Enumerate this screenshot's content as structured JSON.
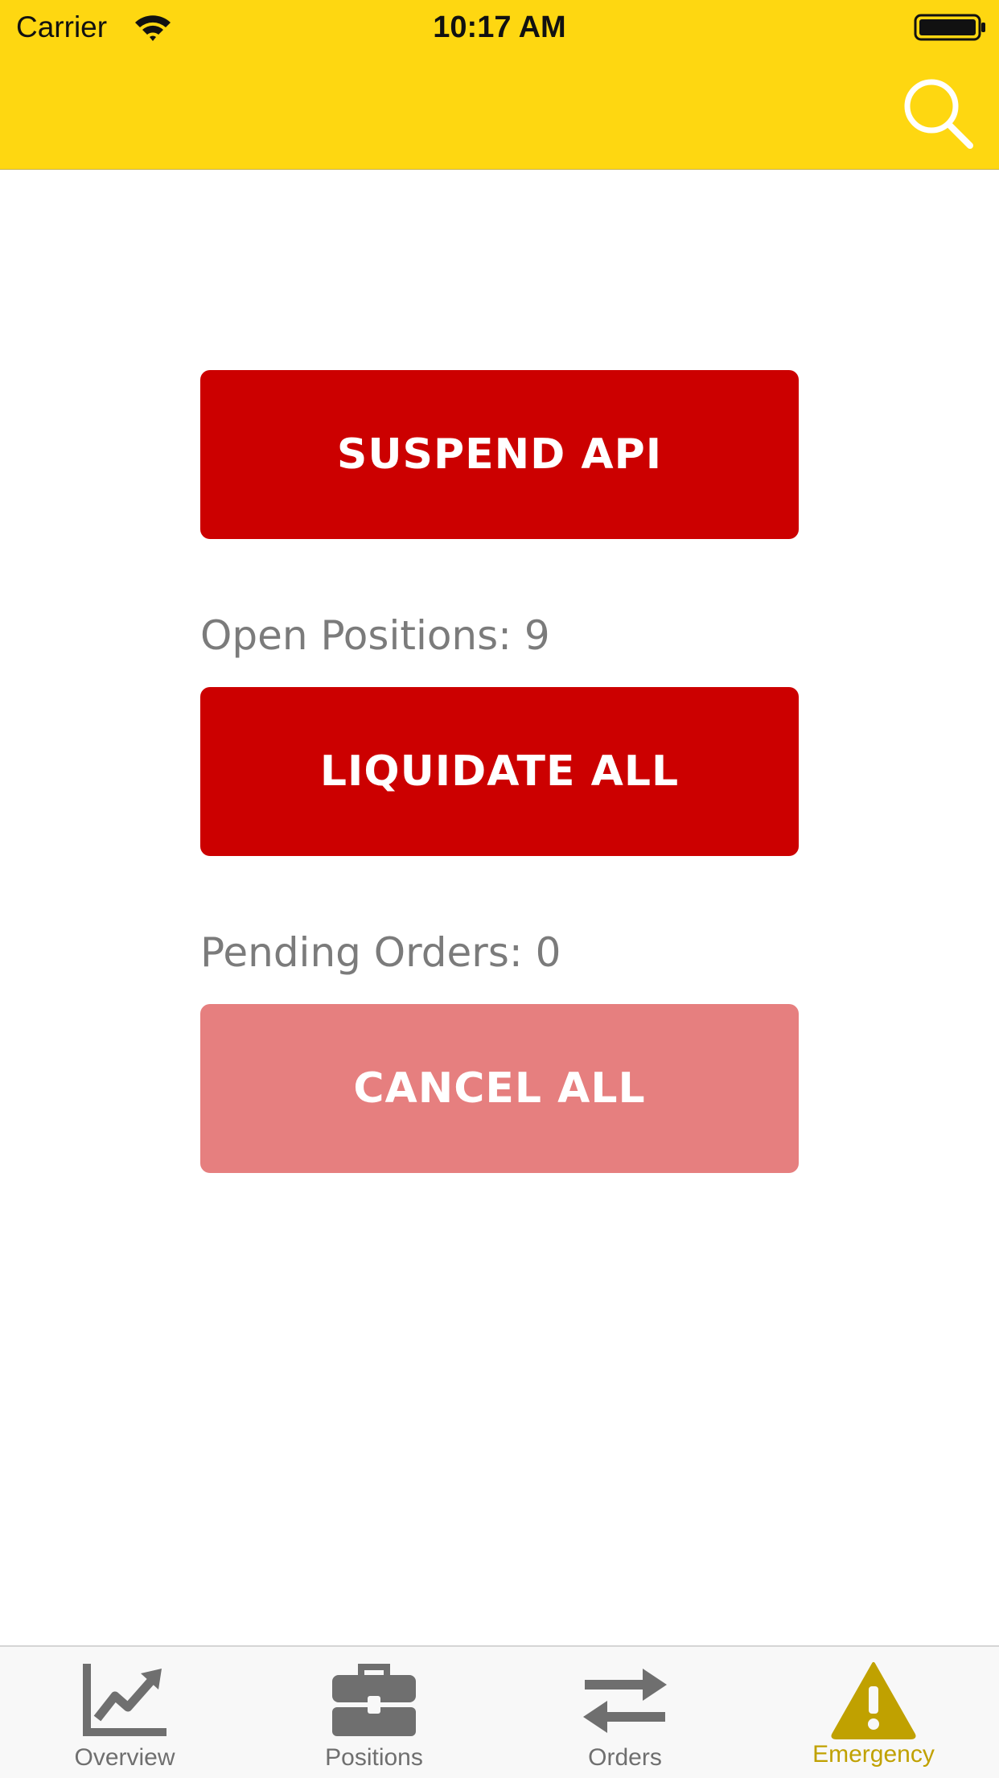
{
  "status_bar": {
    "carrier": "Carrier",
    "time": "10:17 AM"
  },
  "header": {
    "background_color": "#fed711",
    "search_icon": "search-icon"
  },
  "actions": {
    "suspend_label": "SUSPEND API",
    "open_positions_text": "Open Positions: 9",
    "liquidate_label": "LIQUIDATE ALL",
    "pending_orders_text": "Pending Orders: 0",
    "cancel_label": "CANCEL ALL",
    "button_color": "#cc0000",
    "disabled_button_color": "#e67f7f"
  },
  "tab_bar": {
    "active_tab": "Emergency",
    "active_color": "#c0a100",
    "inactive_color": "#6f6f6f",
    "tabs": [
      {
        "label": "Overview",
        "icon": "chart-icon"
      },
      {
        "label": "Positions",
        "icon": "briefcase-icon"
      },
      {
        "label": "Orders",
        "icon": "swap-arrows-icon"
      },
      {
        "label": "Emergency",
        "icon": "warning-icon"
      }
    ]
  }
}
